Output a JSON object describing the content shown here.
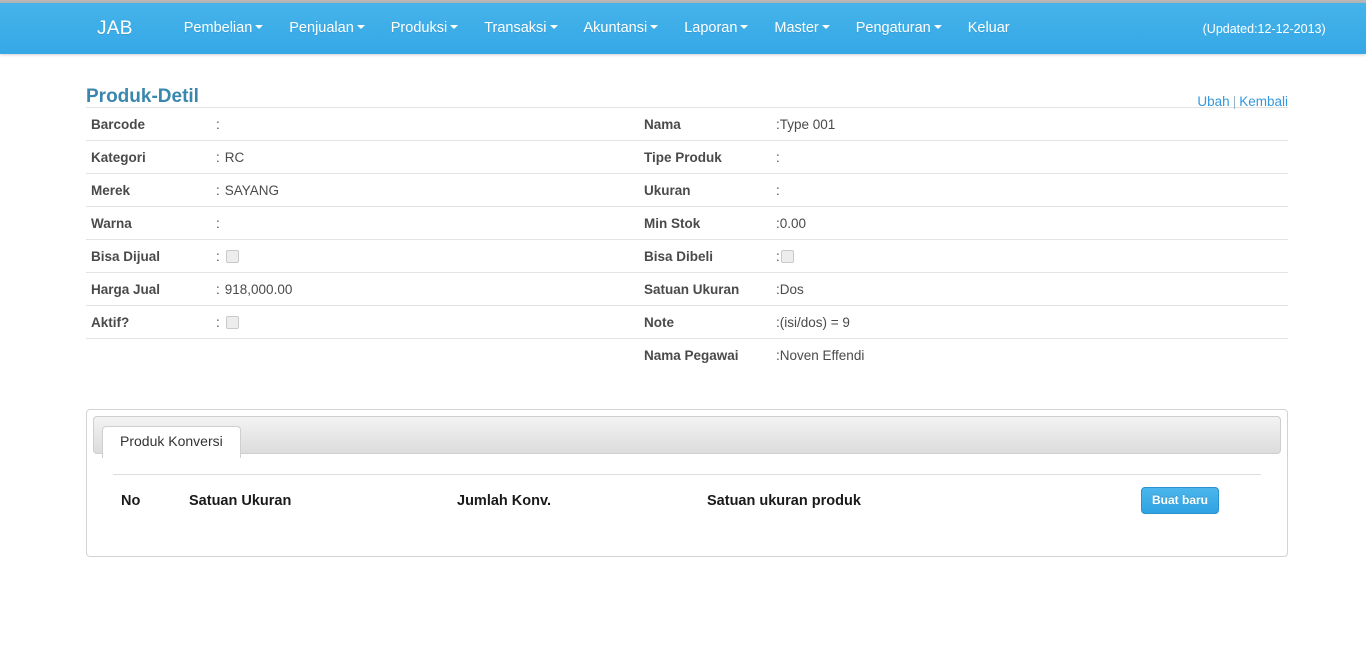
{
  "navbar": {
    "brand": "JAB",
    "items": [
      {
        "label": "Pembelian",
        "caret": true
      },
      {
        "label": "Penjualan",
        "caret": true
      },
      {
        "label": "Produksi",
        "caret": true
      },
      {
        "label": "Transaksi",
        "caret": true
      },
      {
        "label": "Akuntansi",
        "caret": true
      },
      {
        "label": "Laporan",
        "caret": true
      },
      {
        "label": "Master",
        "caret": true
      },
      {
        "label": "Pengaturan",
        "caret": true
      },
      {
        "label": "Keluar",
        "caret": false
      }
    ],
    "updated": "(Updated:12-12-2013)",
    "bg_color": "#3daee9"
  },
  "page": {
    "title": "Produk-Detil",
    "title_color": "#3a87ad",
    "actions": {
      "edit_label": "Ubah",
      "separator": "|",
      "back_label": "Kembali",
      "link_color": "#3498db"
    }
  },
  "detail": {
    "rows": [
      {
        "left": {
          "label": "Barcode",
          "colon": ":",
          "value": "",
          "type": "text"
        },
        "right": {
          "label": "Nama",
          "colon": ":",
          "value": "Type 001",
          "type": "text"
        }
      },
      {
        "left": {
          "label": "Kategori",
          "colon": ":",
          "value": "RC",
          "type": "text"
        },
        "right": {
          "label": "Tipe Produk",
          "colon": ":",
          "value": "",
          "type": "text"
        }
      },
      {
        "left": {
          "label": "Merek",
          "colon": ":",
          "value": "SAYANG",
          "type": "text"
        },
        "right": {
          "label": "Ukuran",
          "colon": ":",
          "value": "",
          "type": "text"
        }
      },
      {
        "left": {
          "label": "Warna",
          "colon": ":",
          "value": "",
          "type": "text"
        },
        "right": {
          "label": "Min Stok",
          "colon": ":",
          "value": "0.00",
          "type": "text"
        }
      },
      {
        "left": {
          "label": "Bisa Dijual",
          "colon": ":",
          "value": "",
          "type": "checkbox",
          "checked": false
        },
        "right": {
          "label": "Bisa Dibeli",
          "colon": ":",
          "value": "",
          "type": "checkbox",
          "checked": false
        }
      },
      {
        "left": {
          "label": "Harga Jual",
          "colon": ":",
          "value": "918,000.00",
          "type": "text"
        },
        "right": {
          "label": "Satuan Ukuran",
          "colon": ":",
          "value": "Dos",
          "type": "text"
        }
      },
      {
        "left": {
          "label": "Aktif?",
          "colon": ":",
          "value": "",
          "type": "checkbox",
          "checked": false
        },
        "right": {
          "label": "Note",
          "colon": ":",
          "value": "(isi/dos) = 9",
          "type": "text"
        }
      },
      {
        "left": {
          "label": "",
          "colon": "",
          "value": "",
          "type": "empty"
        },
        "right": {
          "label": "Nama Pegawai",
          "colon": ":",
          "value": "Noven Effendi",
          "type": "text"
        }
      }
    ]
  },
  "tabs": {
    "items": [
      {
        "label": "Produk Konversi",
        "active": true
      }
    ]
  },
  "conversion_table": {
    "headers": [
      "No",
      "Satuan Ukuran",
      "Jumlah Konv.",
      "Satuan ukuran produk"
    ],
    "rows": [],
    "new_button_label": "Buat baru",
    "button_color": "#3daee9"
  }
}
